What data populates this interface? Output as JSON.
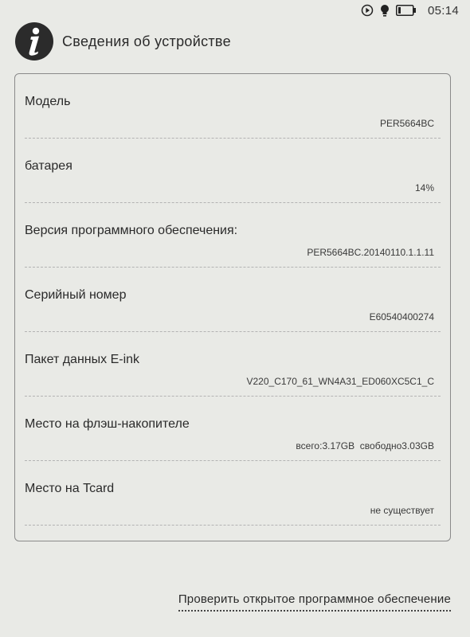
{
  "status_bar": {
    "time": "05:14",
    "icons": [
      "play-circle-icon",
      "bulb-icon",
      "battery-icon"
    ]
  },
  "header": {
    "icon": "info-icon",
    "title": "Сведения об устройстве"
  },
  "info_items": [
    {
      "label": "Модель",
      "value": "PER5664BC"
    },
    {
      "label": "батарея",
      "value": "14%"
    },
    {
      "label": "Версия программного обеспечения:",
      "value": "PER5664BC.20140110.1.1.11"
    },
    {
      "label": "Серийный номер",
      "value": "E60540400274"
    },
    {
      "label": "Пакет данных E-ink",
      "value": "V220_C170_61_WN4A31_ED060XC5C1_C"
    },
    {
      "label": "Место на флэш-накопителе",
      "value": "всего:3.17GB  свободно3.03GB"
    },
    {
      "label": "Место на Tcard",
      "value": "не существует"
    }
  ],
  "footer": {
    "check_link": "Проверить открытое программное обеспечение"
  }
}
